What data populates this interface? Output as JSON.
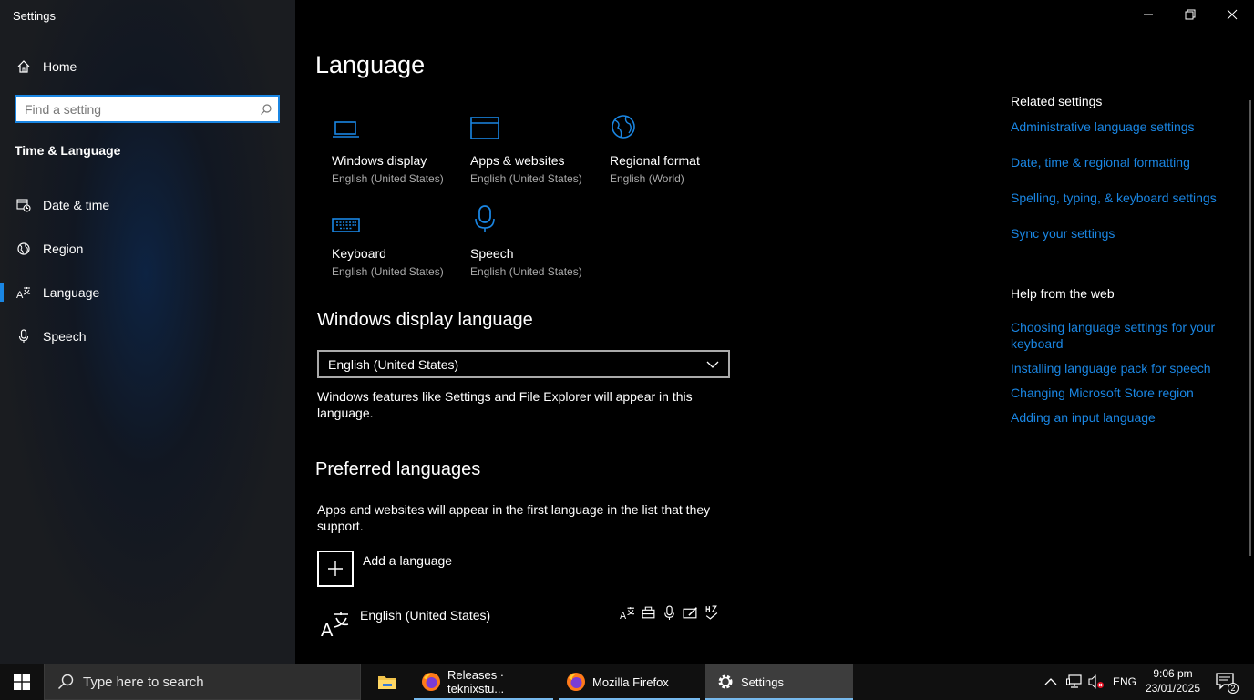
{
  "window": {
    "title": "Settings"
  },
  "sidebar": {
    "home": "Home",
    "search_placeholder": "Find a setting",
    "section": "Time & Language",
    "items": [
      {
        "label": "Date & time",
        "icon": "calendar-clock-icon"
      },
      {
        "label": "Region",
        "icon": "globe-icon"
      },
      {
        "label": "Language",
        "icon": "language-icon",
        "active": true
      },
      {
        "label": "Speech",
        "icon": "microphone-icon"
      }
    ]
  },
  "main": {
    "title": "Language",
    "tiles": [
      {
        "name": "Windows display",
        "sub": "English (United States)",
        "icon": "laptop-icon"
      },
      {
        "name": "Apps & websites",
        "sub": "English (United States)",
        "icon": "browser-window-icon"
      },
      {
        "name": "Regional format",
        "sub": "English (World)",
        "icon": "globe-icon"
      },
      {
        "name": "Keyboard",
        "sub": "English (United States)",
        "icon": "keyboard-icon"
      },
      {
        "name": "Speech",
        "sub": "English (United States)",
        "icon": "microphone-icon"
      }
    ],
    "display_language": {
      "heading": "Windows display language",
      "selected": "English (United States)",
      "description": "Windows features like Settings and File Explorer will appear in this language."
    },
    "preferred": {
      "heading": "Preferred languages",
      "description": "Apps and websites will appear in the first language in the list that they support.",
      "add_label": "Add a language",
      "languages": [
        {
          "name": "English (United States)"
        }
      ]
    }
  },
  "related": {
    "heading": "Related settings",
    "links": [
      "Administrative language settings",
      "Date, time & regional formatting",
      "Spelling, typing, & keyboard settings",
      "Sync your settings"
    ]
  },
  "help": {
    "heading": "Help from the web",
    "links": [
      "Choosing language settings for your keyboard",
      "Installing language pack for speech",
      "Changing Microsoft Store region",
      "Adding an input language"
    ]
  },
  "taskbar": {
    "search_placeholder": "Type here to search",
    "apps": [
      {
        "label": "",
        "icon": "file-explorer-icon"
      },
      {
        "label": "Releases · teknixstu...",
        "icon": "firefox-icon"
      },
      {
        "label": "Mozilla Firefox",
        "icon": "firefox-icon"
      },
      {
        "label": "Settings",
        "icon": "gear-icon"
      }
    ],
    "input_lang": "ENG",
    "time": "9:06 pm",
    "date": "23/01/2025",
    "notifications": "2"
  },
  "colors": {
    "accent": "#1a86e3",
    "link": "#1a86e3",
    "background": "#000000",
    "sidebar": "#1c1d20",
    "taskbar": "#101010"
  }
}
